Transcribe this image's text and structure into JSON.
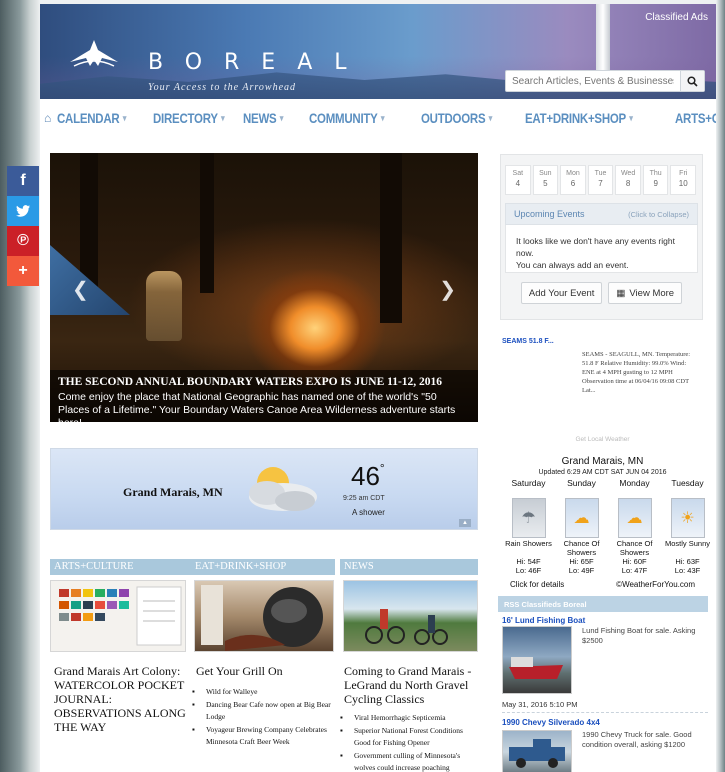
{
  "header": {
    "logo_text": "BOREAL",
    "tagline": "Your Access to the Arrowhead",
    "classified_link": "Classified Ads",
    "search_placeholder": "Search Articles, Events & Businesses"
  },
  "nav": {
    "items": [
      {
        "label": "CALENDAR"
      },
      {
        "label": "DIRECTORY"
      },
      {
        "label": "NEWS"
      },
      {
        "label": "COMMUNITY"
      },
      {
        "label": "OUTDOORS"
      },
      {
        "label": "EAT+DRINK+SHOP"
      },
      {
        "label": "ARTS+CULTURE"
      }
    ]
  },
  "social": {
    "icons": [
      "facebook-icon",
      "twitter-icon",
      "pinterest-icon",
      "plus-icon"
    ]
  },
  "hero": {
    "title": "THE SECOND ANNUAL BOUNDARY WATERS EXPO IS JUNE 11-12, 2016",
    "text": "Come enjoy the place that National Geographic has named one of the world's \"50 Places of a Lifetime.\" Your Boundary Waters Canoe Area Wilderness adventure starts here!"
  },
  "calendar": {
    "days": [
      {
        "name": "Sat",
        "num": "4"
      },
      {
        "name": "Sun",
        "num": "5"
      },
      {
        "name": "Mon",
        "num": "6"
      },
      {
        "name": "Tue",
        "num": "7"
      },
      {
        "name": "Wed",
        "num": "8"
      },
      {
        "name": "Thu",
        "num": "9"
      },
      {
        "name": "Fri",
        "num": "10"
      }
    ],
    "upcoming_label": "Upcoming Events",
    "collapse_label": "(Click to Collapse)",
    "empty_line1": "It looks like we don't have any events right now.",
    "empty_line2": "You can always add an event.",
    "add_button": "Add Your Event",
    "view_more_button": "View More"
  },
  "station": {
    "link": "SEAMS 51.8 F...",
    "text": "SEAMS - SEAGULL, MN. Temperature: 51.8 F Relative Humidity: 99.0% Wind: ENE at 4 MPH gusting to 12 MPH Observation time at 06/04/16 09:08 CDT Lat..."
  },
  "weather": {
    "city": "Grand Marais, MN",
    "temp": "46",
    "deg": "°",
    "time": "9:25 am CDT",
    "condition": "A shower"
  },
  "forecast": {
    "title": "Get Local Weather",
    "city": "Grand Marais, MN",
    "updated": "Updated 6:29 AM CDT SAT JUN 04 2016",
    "days": [
      {
        "name": "Saturday",
        "cond": "Rain Showers",
        "hi": "Hi: 54F",
        "lo": "Lo: 46F",
        "icon": "rain-icon"
      },
      {
        "name": "Sunday",
        "cond": "Chance Of Showers",
        "hi": "Hi: 65F",
        "lo": "Lo: 49F",
        "icon": "shower-icon"
      },
      {
        "name": "Monday",
        "cond": "Chance Of Showers",
        "hi": "Hi: 60F",
        "lo": "Lo: 47F",
        "icon": "shower-icon"
      },
      {
        "name": "Tuesday",
        "cond": "Mostly Sunny",
        "hi": "Hi: 63F",
        "lo": "Lo: 43F",
        "icon": "sun-icon"
      }
    ],
    "click_details": "Click for details",
    "credit": "©WeatherForYou.com"
  },
  "classifieds": {
    "header": "RSS Classifieds Boreal",
    "ads": [
      {
        "title": "16' Lund Fishing Boat",
        "text": "Lund Fishing Boat for sale. Asking $2500",
        "date": "May 31, 2016 5:10 PM"
      },
      {
        "title": "1990 Chevy Silverado 4x4",
        "text": "1990 Chevy Truck for sale. Good condition overall, asking $1200"
      }
    ]
  },
  "sections": [
    {
      "label": "ARTS+CULTURE",
      "heading": "Grand Marais Art Colony: WATERCOLOR POCKET JOURNAL: OBSERVATIONS ALONG THE WAY",
      "bullets": []
    },
    {
      "label": "EAT+DRINK+SHOP",
      "heading": "Get Your Grill On",
      "bullets": [
        "Wild for Walleye",
        "Dancing Bear Cafe now open at Big Bear Lodge",
        "Voyageur Brewing Company Celebrates Minnesota Craft Beer Week"
      ]
    },
    {
      "label": "NEWS",
      "heading": "Coming to Grand Marais - LeGrand du North Gravel Cycling Classics",
      "bullets": [
        "Viral Hemorrhagic Septicemia",
        "Superior National Forest Conditions Good for Fishing Opener",
        "Government culling of Minnesota's wolves could increase poaching"
      ]
    }
  ]
}
